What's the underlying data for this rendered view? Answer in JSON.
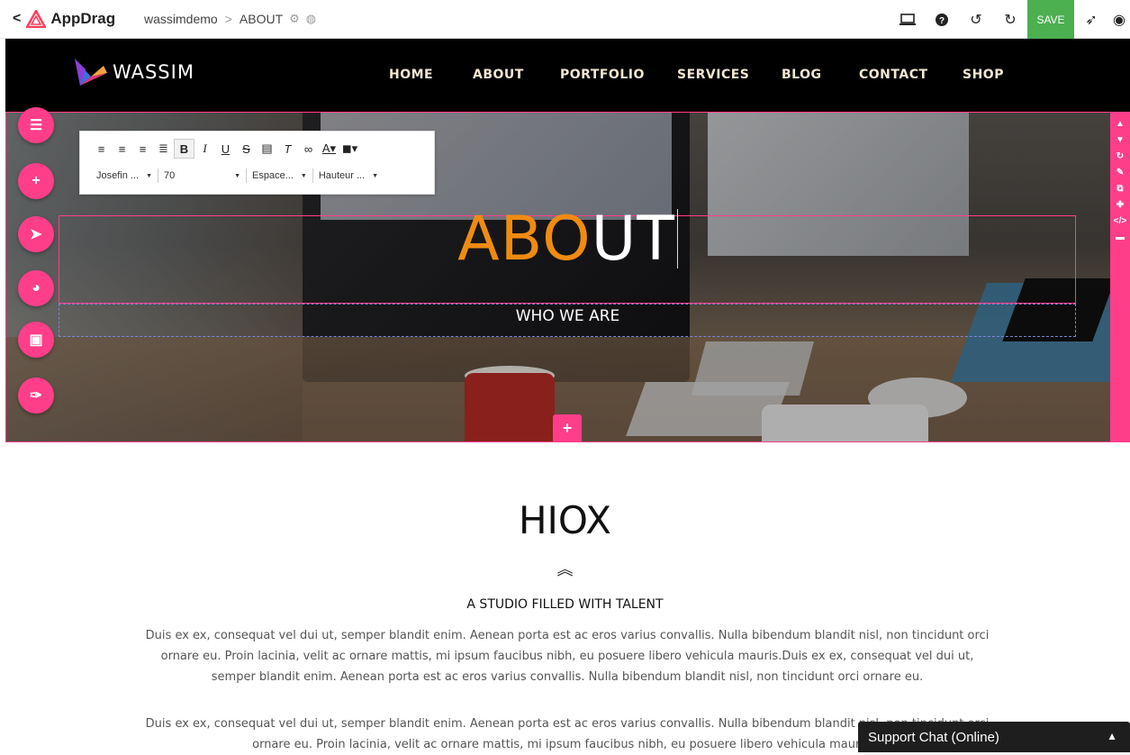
{
  "editor": {
    "back_glyph": "<",
    "brand": "AppDrag",
    "site": "wassimdemo",
    "separator": ">",
    "page": "ABOUT",
    "save": "SAVE",
    "icons": [
      "monitor-icon",
      "help-icon",
      "undo-icon",
      "redo-icon",
      "send-icon",
      "eye-icon"
    ]
  },
  "site": {
    "logo": "WASSIM",
    "menu": [
      "HOME",
      "ABOUT",
      "PORTFOLIO",
      "SERVICES",
      "BLOG",
      "CONTACT",
      "SHOP"
    ]
  },
  "hero": {
    "title_accent": "ABO",
    "title_rest": "UT",
    "subtitle": "WHO WE ARE"
  },
  "text_toolbar": {
    "bold": "B",
    "italic": "I",
    "underline": "U",
    "strike": "S",
    "font_family": "Josefin ...",
    "font_size": "70",
    "letter_spacing": "Espace...",
    "line_height": "Hauteur ..."
  },
  "left_tools": [
    "list-icon",
    "add-icon",
    "rocket-icon",
    "globe-icon",
    "archive-icon",
    "wrench-icon"
  ],
  "right_tools": [
    "arrow-up-icon",
    "arrow-down-icon",
    "refresh-icon",
    "brush-icon",
    "copy-icon",
    "group-icon",
    "code-icon",
    "trash-icon"
  ],
  "content": {
    "title": "HIOX",
    "subtitle": "A STUDIO FILLED WITH TALENT",
    "para1": "Duis ex ex, consequat vel dui ut, semper blandit enim. Aenean porta est ac eros varius convallis. Nulla bibendum blandit nisl, non tincidunt orci ornare eu. Proin lacinia, velit ac ornare mattis, mi ipsum faucibus nibh, eu posuere libero vehicula mauris.Duis ex ex, consequat vel dui ut, semper blandit enim. Aenean porta est ac eros varius convallis. Nulla bibendum blandit nisl, non tincidunt orci ornare eu.",
    "para2": "Duis ex ex, consequat vel dui ut, semper blandit enim. Aenean porta est ac eros varius convallis. Nulla bibendum blandit nisl, non tincidunt orci ornare eu. Proin lacinia, velit ac ornare mattis, mi ipsum faucibus nibh, eu posuere libero vehicula mauris.D"
  },
  "chat": {
    "label": "Support Chat (Online)"
  },
  "colors": {
    "accent_pink": "#ff3e8a",
    "title_orange": "#f08b12",
    "save_green": "#4caf50"
  }
}
